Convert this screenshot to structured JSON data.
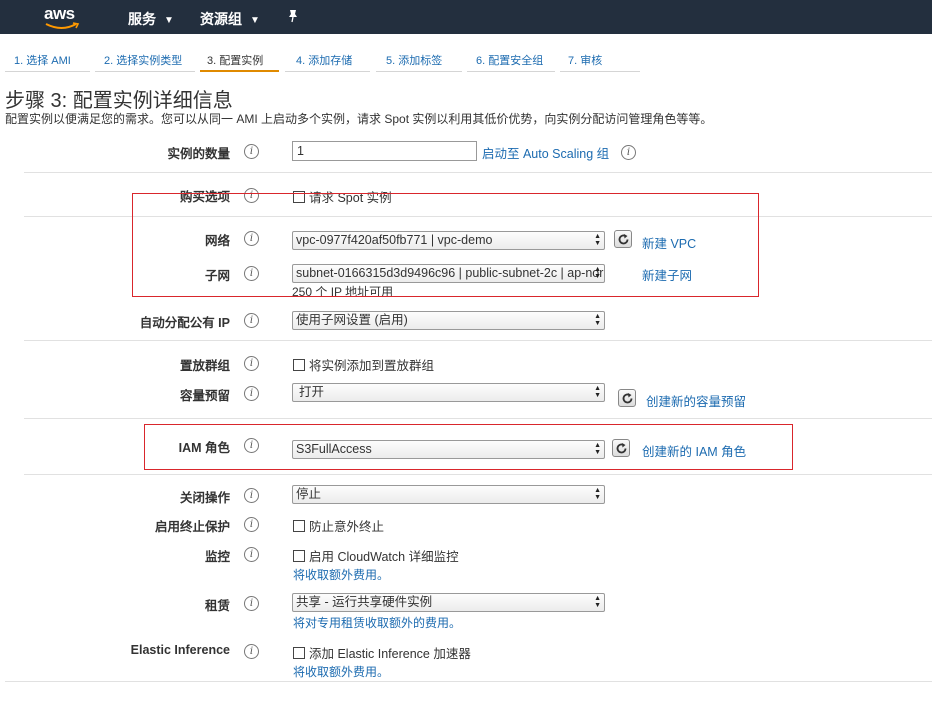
{
  "topnav": {
    "logo_text": "aws",
    "services": "服务",
    "resource_groups": "资源组",
    "caret": "⌄"
  },
  "steps": [
    {
      "label": "1. 选择 AMI"
    },
    {
      "label": "2. 选择实例类型"
    },
    {
      "label": "3. 配置实例"
    },
    {
      "label": "4. 添加存储"
    },
    {
      "label": "5. 添加标签"
    },
    {
      "label": "6. 配置安全组"
    },
    {
      "label": "7. 审核"
    }
  ],
  "active_step_index": 2,
  "page": {
    "title": "步骤 3: 配置实例详细信息",
    "description": "配置实例以便满足您的需求。您可以从同一 AMI 上启动多个实例，请求 Spot 实例以利用其低价优势，向实例分配访问管理角色等等。"
  },
  "info_glyph": "i",
  "fields": {
    "instance_count": {
      "label": "实例的数量",
      "value": "1",
      "link": "启动至 Auto Scaling 组"
    },
    "purchase": {
      "label": "购买选项",
      "checkbox_label": "请求 Spot 实例"
    },
    "network": {
      "label": "网络",
      "value": "vpc-0977f420af50fb771 | vpc-demo",
      "link": "新建 VPC"
    },
    "subnet": {
      "label": "子网",
      "value": "subnet-0166315d3d9496c96 | public-subnet-2c | ap-nor",
      "helper": "250 个 IP 地址可用",
      "link": "新建子网"
    },
    "public_ip": {
      "label": "自动分配公有 IP",
      "value": "使用子网设置 (启用)"
    },
    "placement": {
      "label": "置放群组",
      "checkbox_label": "将实例添加到置放群组"
    },
    "capacity": {
      "label": "容量预留",
      "value": "打开",
      "link": "创建新的容量预留"
    },
    "iam": {
      "label": "IAM 角色",
      "value": "S3FullAccess",
      "link": "创建新的 IAM 角色"
    },
    "shutdown": {
      "label": "关闭操作",
      "value": "停止"
    },
    "termination": {
      "label": "启用终止保护",
      "checkbox_label": "防止意外终止"
    },
    "monitoring": {
      "label": "监控",
      "checkbox_label": "启用 CloudWatch 详细监控",
      "helper": "将收取额外费用。"
    },
    "tenancy": {
      "label": "租赁",
      "value": "共享 - 运行共享硬件实例",
      "helper": "将对专用租赁收取额外的费用。"
    },
    "elastic_inference": {
      "label": "Elastic Inference",
      "checkbox_label": "添加 Elastic Inference 加速器",
      "helper": "将收取额外费用。"
    }
  },
  "colors": {
    "nav_bg": "#232f3e",
    "link": "#1c6bb0",
    "active_step_underline": "#e08a00",
    "highlight_box": "#d9262c"
  }
}
